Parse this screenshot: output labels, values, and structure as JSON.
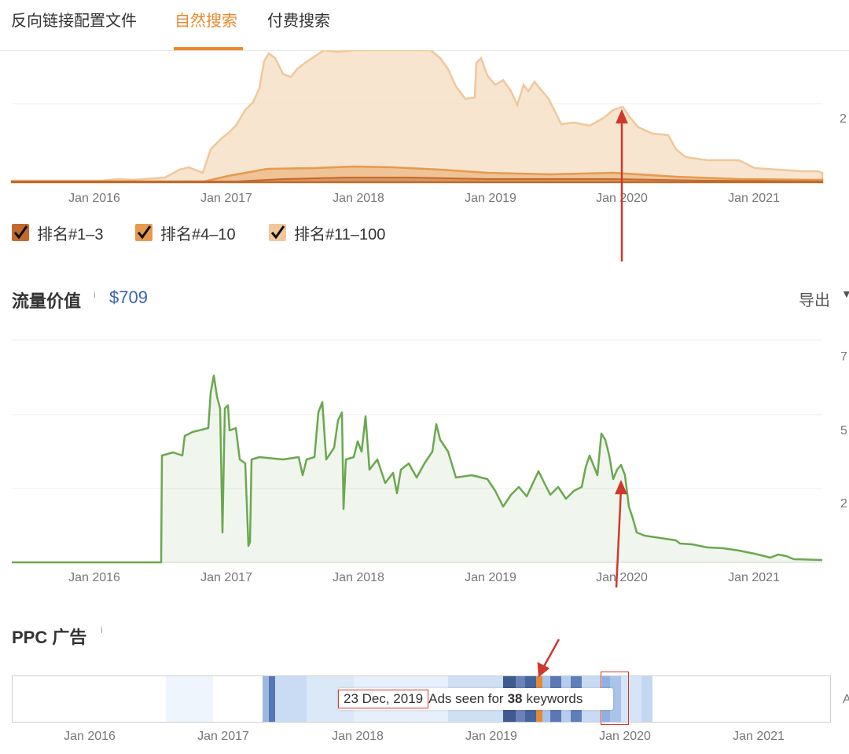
{
  "tabs": [
    {
      "label": "反向链接配置文件"
    },
    {
      "label": "自然搜索"
    },
    {
      "label": "付费搜索"
    }
  ],
  "colors": {
    "accent": "#e8892b",
    "rank_1_3": "#c1692e",
    "rank_4_10": "#e59a4e",
    "rank_11_100": "#f0c79b",
    "traffic_value_line": "#6aa84f",
    "annotation_red": "#d0382b",
    "link_blue": "#3a63b8"
  },
  "x_axis_labels": [
    "Jan 2016",
    "Jan 2017",
    "Jan 2018",
    "Jan 2019",
    "Jan 2020",
    "Jan 2021"
  ],
  "legend": [
    {
      "label": "排名#1–3",
      "color": "#c1692e"
    },
    {
      "label": "排名#4–10",
      "color": "#e59a4e"
    },
    {
      "label": "排名#11–100",
      "color": "#f0c79b"
    }
  ],
  "traffic_value": {
    "title": "流量价值",
    "info": "i",
    "value": "$709",
    "export_label": "导出",
    "export_icon": "chevron-down-icon",
    "y_tick_fragments": [
      "7",
      "5",
      "2"
    ]
  },
  "organic": {
    "y_tick_fragment": "2"
  },
  "ppc": {
    "title": "PPC 广告",
    "info": "i",
    "tooltip_date": "23 Dec, 2019",
    "tooltip_prefix": "Ads seen for",
    "tooltip_count": "38",
    "tooltip_suffix": "keywords",
    "right_fragment": "A"
  }
}
